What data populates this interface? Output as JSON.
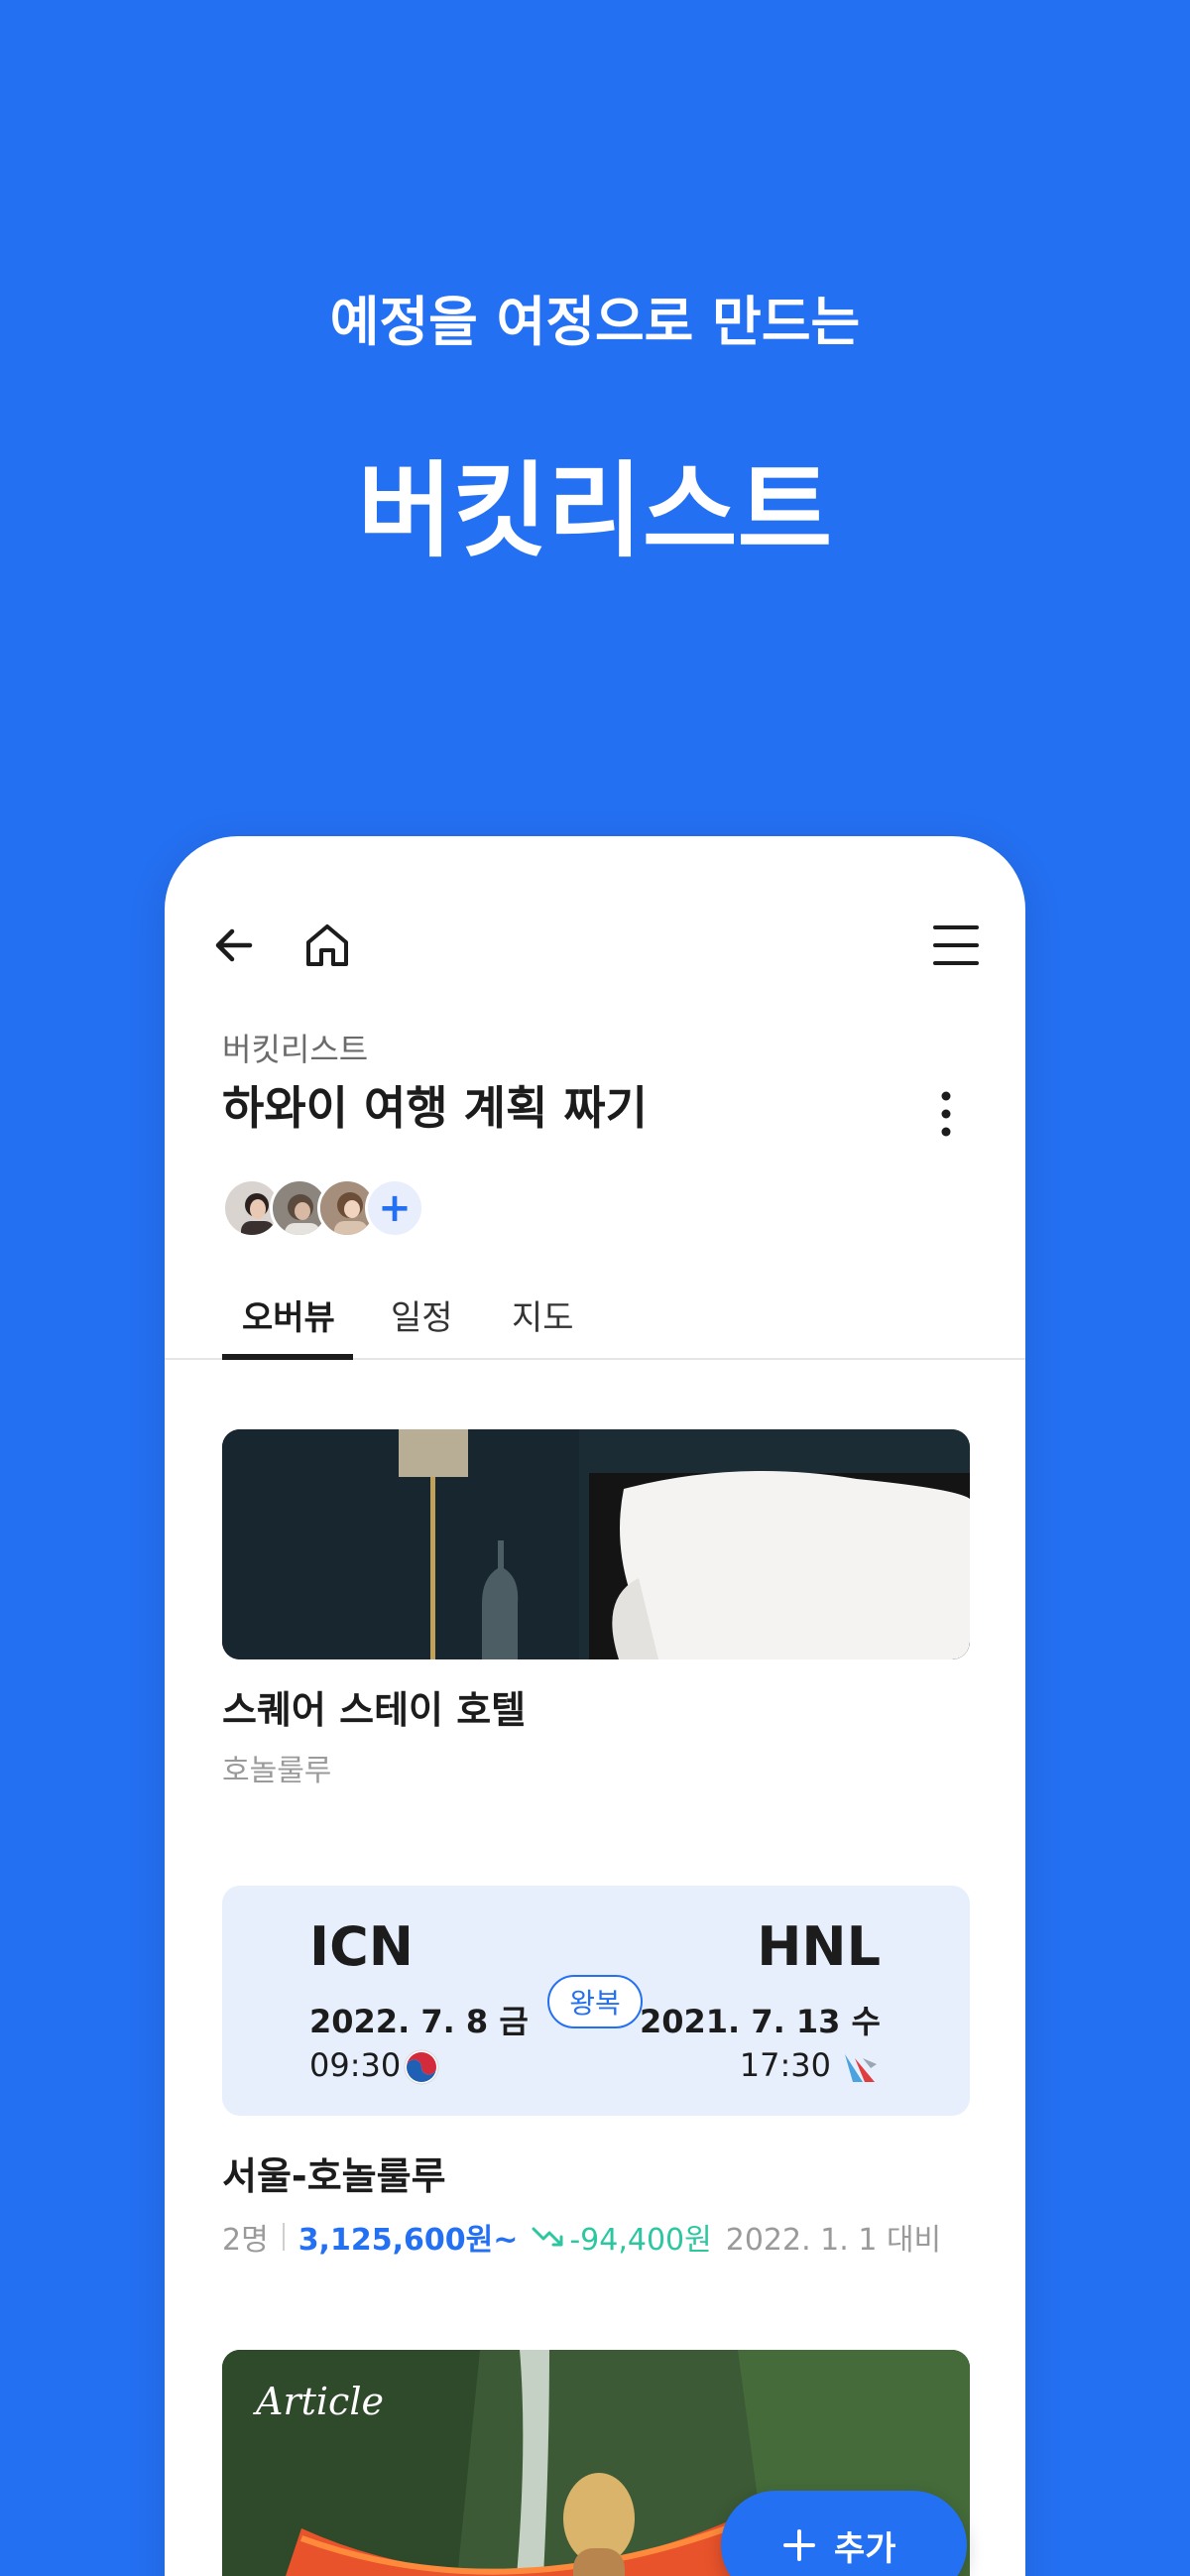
{
  "hero": {
    "subtitle": "예정을 여정으로 만드는",
    "title": "버킷리스트"
  },
  "header": {
    "breadcrumb": "버킷리스트",
    "title": "하와이 여행 계획 짜기",
    "icons": [
      "back-arrow-icon",
      "home-icon",
      "hamburger-menu-icon",
      "more-vertical-icon"
    ]
  },
  "members": {
    "add_label": "+"
  },
  "tabs": [
    {
      "label": "오버뷰",
      "active": true
    },
    {
      "label": "일정",
      "active": false
    },
    {
      "label": "지도",
      "active": false
    }
  ],
  "hotel": {
    "name": "스퀘어 스테이 호텔",
    "location": "호놀룰루"
  },
  "flight": {
    "from_code": "ICN",
    "from_date": "2022. 7. 8 금",
    "from_time": "09:30",
    "to_code": "HNL",
    "to_date": "2021. 7. 13 수",
    "to_time": "17:30",
    "trip_type": "왕복",
    "title": "서울-호놀룰루",
    "passengers": "2명",
    "price": "3,125,600원~",
    "price_change": "-94,400원",
    "compare_date": "2022. 1. 1 대비"
  },
  "article": {
    "tag": "Article"
  },
  "fab": {
    "label": "추가"
  },
  "colors": {
    "brand": "#2470f2",
    "card_bg": "#e7eefc",
    "price_drop": "#2cc7a0"
  }
}
